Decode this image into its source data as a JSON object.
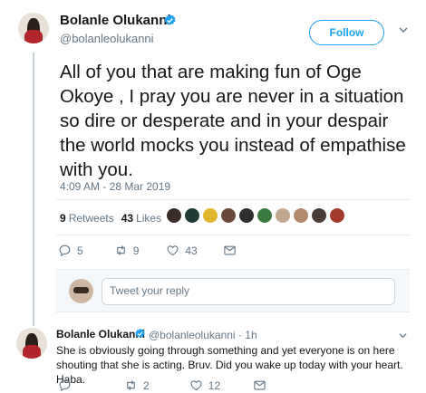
{
  "tweet": {
    "author_name": "Bolanle Olukanni",
    "author_handle": "@bolanleolukanni",
    "follow_label": "Follow",
    "text": "All of you that are making fun of Oge Okoye , I pray you are never in a situation so dire or desperate and in your despair the world mocks you instead of empathise with you.",
    "timestamp": "4:09 AM - 28 Mar 2019",
    "retweets_count": "9",
    "retweets_label": "Retweets",
    "likes_count": "43",
    "likes_label": "Likes",
    "actions": {
      "replies": "5",
      "retweets": "9",
      "likes": "43"
    }
  },
  "reply_box": {
    "placeholder": "Tweet your reply"
  },
  "reply": {
    "author_name": "Bolanle Olukanni",
    "author_handle": "@bolanleolukanni",
    "time": "1h",
    "text": "She is obviously going through something and yet everyone is on here shouting that she is acting. Bruv. Did you wake up today with your heart. Haba.",
    "actions": {
      "replies": "",
      "retweets": "2",
      "likes": "12"
    }
  },
  "liker_colors": [
    "#3a2d27",
    "#1f3b35",
    "#e1b52b",
    "#6b4a3a",
    "#2e2e2e",
    "#3d7a3f",
    "#c1a88f",
    "#b48a6c",
    "#4a3b34",
    "#a33b2c"
  ],
  "colors": {
    "accent": "#1da1f2",
    "text": "#14171a",
    "muted": "#657786"
  },
  "icons": [
    "verified-badge-icon",
    "chevron-down-icon",
    "reply-icon",
    "retweet-icon",
    "heart-icon",
    "envelope-icon"
  ]
}
